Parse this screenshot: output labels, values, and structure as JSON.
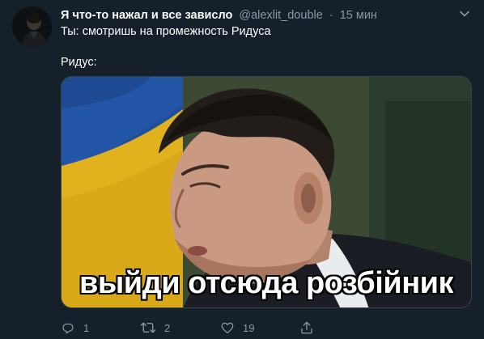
{
  "tweet": {
    "display_name": "Я что-то нажал и все зависло",
    "handle": "@alexlit_double",
    "separator": "·",
    "time": "15 мин",
    "text_line1": "Ты: смотришь на промежность Ридуса",
    "text_line2": "Ридус:",
    "media": {
      "caption": "выйди отсюда розбійник"
    },
    "actions": {
      "reply_count": "1",
      "retweet_count": "2",
      "like_count": "19"
    }
  },
  "icons": {
    "caret": "chevron-down-icon",
    "reply": "reply-icon",
    "retweet": "retweet-icon",
    "like": "heart-icon",
    "share": "share-icon"
  },
  "colors": {
    "background": "#15202b",
    "secondary_text": "#8899a6",
    "primary_text": "#ffffff",
    "border": "#38444d"
  }
}
